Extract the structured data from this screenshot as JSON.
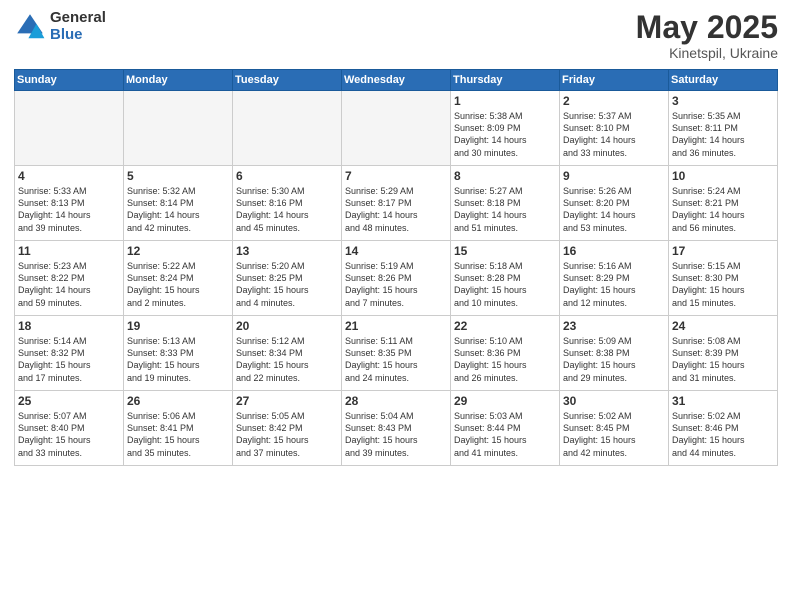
{
  "logo": {
    "general": "General",
    "blue": "Blue"
  },
  "title": "May 2025",
  "location": "Kinetspil, Ukraine",
  "headers": [
    "Sunday",
    "Monday",
    "Tuesday",
    "Wednesday",
    "Thursday",
    "Friday",
    "Saturday"
  ],
  "weeks": [
    [
      {
        "day": "",
        "info": ""
      },
      {
        "day": "",
        "info": ""
      },
      {
        "day": "",
        "info": ""
      },
      {
        "day": "",
        "info": ""
      },
      {
        "day": "1",
        "info": "Sunrise: 5:38 AM\nSunset: 8:09 PM\nDaylight: 14 hours\nand 30 minutes."
      },
      {
        "day": "2",
        "info": "Sunrise: 5:37 AM\nSunset: 8:10 PM\nDaylight: 14 hours\nand 33 minutes."
      },
      {
        "day": "3",
        "info": "Sunrise: 5:35 AM\nSunset: 8:11 PM\nDaylight: 14 hours\nand 36 minutes."
      }
    ],
    [
      {
        "day": "4",
        "info": "Sunrise: 5:33 AM\nSunset: 8:13 PM\nDaylight: 14 hours\nand 39 minutes."
      },
      {
        "day": "5",
        "info": "Sunrise: 5:32 AM\nSunset: 8:14 PM\nDaylight: 14 hours\nand 42 minutes."
      },
      {
        "day": "6",
        "info": "Sunrise: 5:30 AM\nSunset: 8:16 PM\nDaylight: 14 hours\nand 45 minutes."
      },
      {
        "day": "7",
        "info": "Sunrise: 5:29 AM\nSunset: 8:17 PM\nDaylight: 14 hours\nand 48 minutes."
      },
      {
        "day": "8",
        "info": "Sunrise: 5:27 AM\nSunset: 8:18 PM\nDaylight: 14 hours\nand 51 minutes."
      },
      {
        "day": "9",
        "info": "Sunrise: 5:26 AM\nSunset: 8:20 PM\nDaylight: 14 hours\nand 53 minutes."
      },
      {
        "day": "10",
        "info": "Sunrise: 5:24 AM\nSunset: 8:21 PM\nDaylight: 14 hours\nand 56 minutes."
      }
    ],
    [
      {
        "day": "11",
        "info": "Sunrise: 5:23 AM\nSunset: 8:22 PM\nDaylight: 14 hours\nand 59 minutes."
      },
      {
        "day": "12",
        "info": "Sunrise: 5:22 AM\nSunset: 8:24 PM\nDaylight: 15 hours\nand 2 minutes."
      },
      {
        "day": "13",
        "info": "Sunrise: 5:20 AM\nSunset: 8:25 PM\nDaylight: 15 hours\nand 4 minutes."
      },
      {
        "day": "14",
        "info": "Sunrise: 5:19 AM\nSunset: 8:26 PM\nDaylight: 15 hours\nand 7 minutes."
      },
      {
        "day": "15",
        "info": "Sunrise: 5:18 AM\nSunset: 8:28 PM\nDaylight: 15 hours\nand 10 minutes."
      },
      {
        "day": "16",
        "info": "Sunrise: 5:16 AM\nSunset: 8:29 PM\nDaylight: 15 hours\nand 12 minutes."
      },
      {
        "day": "17",
        "info": "Sunrise: 5:15 AM\nSunset: 8:30 PM\nDaylight: 15 hours\nand 15 minutes."
      }
    ],
    [
      {
        "day": "18",
        "info": "Sunrise: 5:14 AM\nSunset: 8:32 PM\nDaylight: 15 hours\nand 17 minutes."
      },
      {
        "day": "19",
        "info": "Sunrise: 5:13 AM\nSunset: 8:33 PM\nDaylight: 15 hours\nand 19 minutes."
      },
      {
        "day": "20",
        "info": "Sunrise: 5:12 AM\nSunset: 8:34 PM\nDaylight: 15 hours\nand 22 minutes."
      },
      {
        "day": "21",
        "info": "Sunrise: 5:11 AM\nSunset: 8:35 PM\nDaylight: 15 hours\nand 24 minutes."
      },
      {
        "day": "22",
        "info": "Sunrise: 5:10 AM\nSunset: 8:36 PM\nDaylight: 15 hours\nand 26 minutes."
      },
      {
        "day": "23",
        "info": "Sunrise: 5:09 AM\nSunset: 8:38 PM\nDaylight: 15 hours\nand 29 minutes."
      },
      {
        "day": "24",
        "info": "Sunrise: 5:08 AM\nSunset: 8:39 PM\nDaylight: 15 hours\nand 31 minutes."
      }
    ],
    [
      {
        "day": "25",
        "info": "Sunrise: 5:07 AM\nSunset: 8:40 PM\nDaylight: 15 hours\nand 33 minutes."
      },
      {
        "day": "26",
        "info": "Sunrise: 5:06 AM\nSunset: 8:41 PM\nDaylight: 15 hours\nand 35 minutes."
      },
      {
        "day": "27",
        "info": "Sunrise: 5:05 AM\nSunset: 8:42 PM\nDaylight: 15 hours\nand 37 minutes."
      },
      {
        "day": "28",
        "info": "Sunrise: 5:04 AM\nSunset: 8:43 PM\nDaylight: 15 hours\nand 39 minutes."
      },
      {
        "day": "29",
        "info": "Sunrise: 5:03 AM\nSunset: 8:44 PM\nDaylight: 15 hours\nand 41 minutes."
      },
      {
        "day": "30",
        "info": "Sunrise: 5:02 AM\nSunset: 8:45 PM\nDaylight: 15 hours\nand 42 minutes."
      },
      {
        "day": "31",
        "info": "Sunrise: 5:02 AM\nSunset: 8:46 PM\nDaylight: 15 hours\nand 44 minutes."
      }
    ]
  ]
}
